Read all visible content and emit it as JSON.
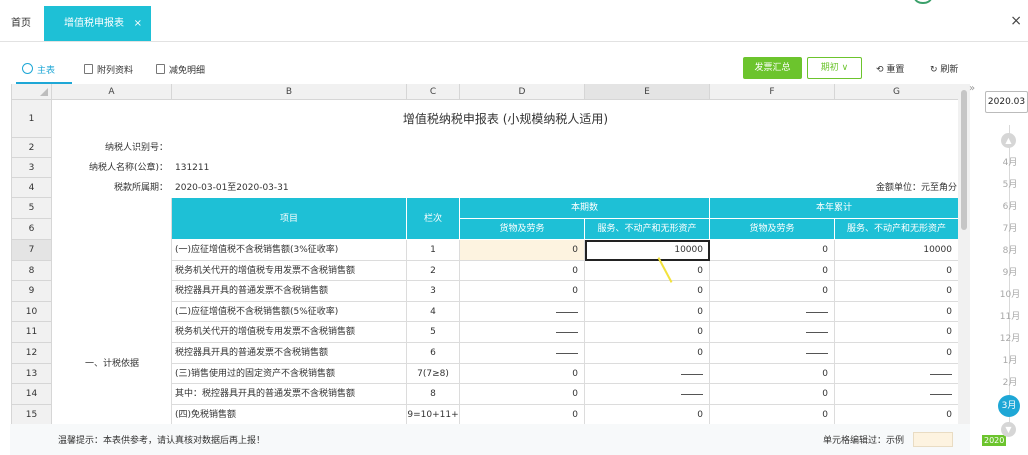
{
  "tabs": {
    "home": "首页",
    "active": "增值税申报表",
    "active_close": "×",
    "window_close": "×"
  },
  "subtabs": [
    "主表",
    "附列资料",
    "减免明细"
  ],
  "toolbar": {
    "summary": "发票汇总",
    "period": "期初 ∨",
    "reset": "重置",
    "refresh": "刷新"
  },
  "columns": [
    "A",
    "B",
    "C",
    "D",
    "E",
    "F",
    "G"
  ],
  "sheet": {
    "title": "增值税纳税申报表 (小规模纳税人适用)",
    "tax_id_label": "纳税人识别号：",
    "name_label": "纳税人名称(公章)：",
    "name_value": "131211",
    "period_label": "税款所属期：",
    "period_value": "2020-03-01至2020-03-31",
    "unit_label": "金额单位：元至角分",
    "item_header": "项目",
    "line_header": "栏次",
    "current_header": "本期数",
    "ytd_header": "本年累计",
    "goods_header": "货物及劳务",
    "services_header": "服务、不动产和无形资产",
    "section_label": "一、计税依据",
    "rows": [
      {
        "num": "7",
        "item": "(一)应征增值税不含税销售额(3%征收率)",
        "line": "1",
        "d": "0",
        "e": "10000",
        "f": "0",
        "g": "10000"
      },
      {
        "num": "8",
        "item": "税务机关代开的增值税专用发票不含税销售额",
        "line": "2",
        "d": "0",
        "e": "0",
        "f": "0",
        "g": "0"
      },
      {
        "num": "9",
        "item": "税控器具开具的普通发票不含税销售额",
        "line": "3",
        "d": "0",
        "e": "0",
        "f": "0",
        "g": "0"
      },
      {
        "num": "10",
        "item": "(二)应征增值税不含税销售额(5%征收率)",
        "line": "4",
        "d": "—",
        "e": "0",
        "f": "—",
        "g": "0"
      },
      {
        "num": "11",
        "item": "税务机关代开的增值税专用发票不含税销售额",
        "line": "5",
        "d": "—",
        "e": "0",
        "f": "—",
        "g": "0"
      },
      {
        "num": "12",
        "item": "税控器具开具的普通发票不含税销售额",
        "line": "6",
        "d": "—",
        "e": "0",
        "f": "—",
        "g": "0"
      },
      {
        "num": "13",
        "item": "(三)销售使用过的固定资产不含税销售额",
        "line": "7(7≥8)",
        "d": "0",
        "e": "—",
        "f": "0",
        "g": "—"
      },
      {
        "num": "14",
        "item": "其中：税控器具开具的普通发票不含税销售额",
        "line": "8",
        "d": "0",
        "e": "—",
        "f": "0",
        "g": "—"
      },
      {
        "num": "15",
        "item": "(四)免税销售额",
        "line": "9=10+11+",
        "d": "0",
        "e": "0",
        "f": "0",
        "g": "0"
      }
    ]
  },
  "footer": {
    "tip": "温馨提示：本表供参考，请认真核对数据后再上报！",
    "legend": "单元格编辑过：示例"
  },
  "periods": {
    "selected": "2020.03",
    "expander": "»",
    "months": [
      "4月",
      "5月",
      "6月",
      "7月",
      "8月",
      "9月",
      "10月",
      "11月",
      "12月",
      "1月",
      "2月"
    ],
    "active_month": "3月",
    "year_marker": "2020"
  },
  "colors": {
    "accent": "#1ec0d6",
    "green": "#6cc42d",
    "edited": "#fdf3e0"
  }
}
